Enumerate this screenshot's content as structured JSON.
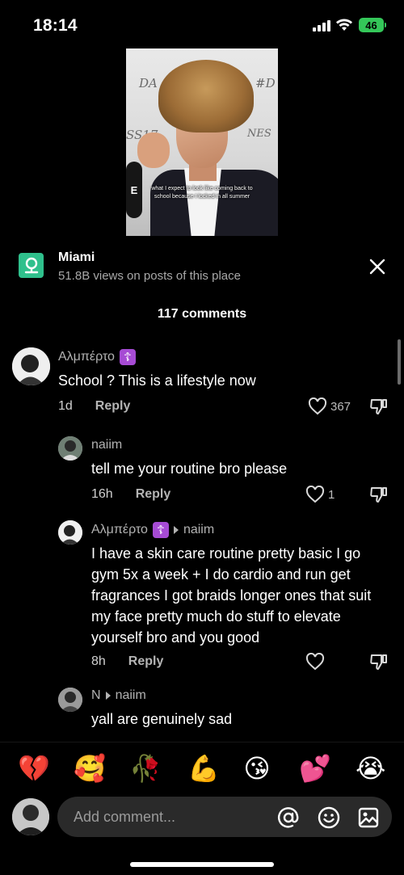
{
  "status_bar": {
    "time": "18:14",
    "battery": "46"
  },
  "video": {
    "caption": "what I expect to look like coming back to school because I locked in all summer",
    "wall_text_left": "DA",
    "wall_text_right": "#D",
    "wall_text_mid": "SS17",
    "wall_text_nes": "NES"
  },
  "location": {
    "title": "Miami",
    "subtitle": "51.8B views on posts of this place"
  },
  "comments_header": "117 comments",
  "comments": [
    {
      "user": "Αλμπέρτο",
      "badge": "☦",
      "text": "School ? This is a lifestyle now",
      "time": "1d",
      "reply_label": "Reply",
      "likes": "367"
    },
    {
      "user": "naiim",
      "text": "tell me your routine bro please",
      "time": "16h",
      "reply_label": "Reply",
      "likes": "1"
    },
    {
      "user": "Αλμπέρτο",
      "badge": "☦",
      "reply_to": "naiim",
      "text": "I have a skin care routine pretty basic I go gym 5x a week + I do cardio and run get fragrances I got braids longer ones that suit my face pretty much do stuff to elevate yourself bro and you good",
      "time": "8h",
      "reply_label": "Reply",
      "likes": ""
    },
    {
      "user": "N",
      "reply_to": "naiim",
      "text": "yall are genuinely sad",
      "time": "",
      "reply_label": "",
      "likes": ""
    }
  ],
  "emoji_bar": [
    "💔",
    "🥰",
    "🥀",
    "💪",
    "😘",
    "💕",
    "😭"
  ],
  "input": {
    "placeholder": "Add comment..."
  },
  "colors": {
    "badge": "#a64bd4",
    "location_icon": "#2fc08c",
    "battery": "#34c759"
  }
}
